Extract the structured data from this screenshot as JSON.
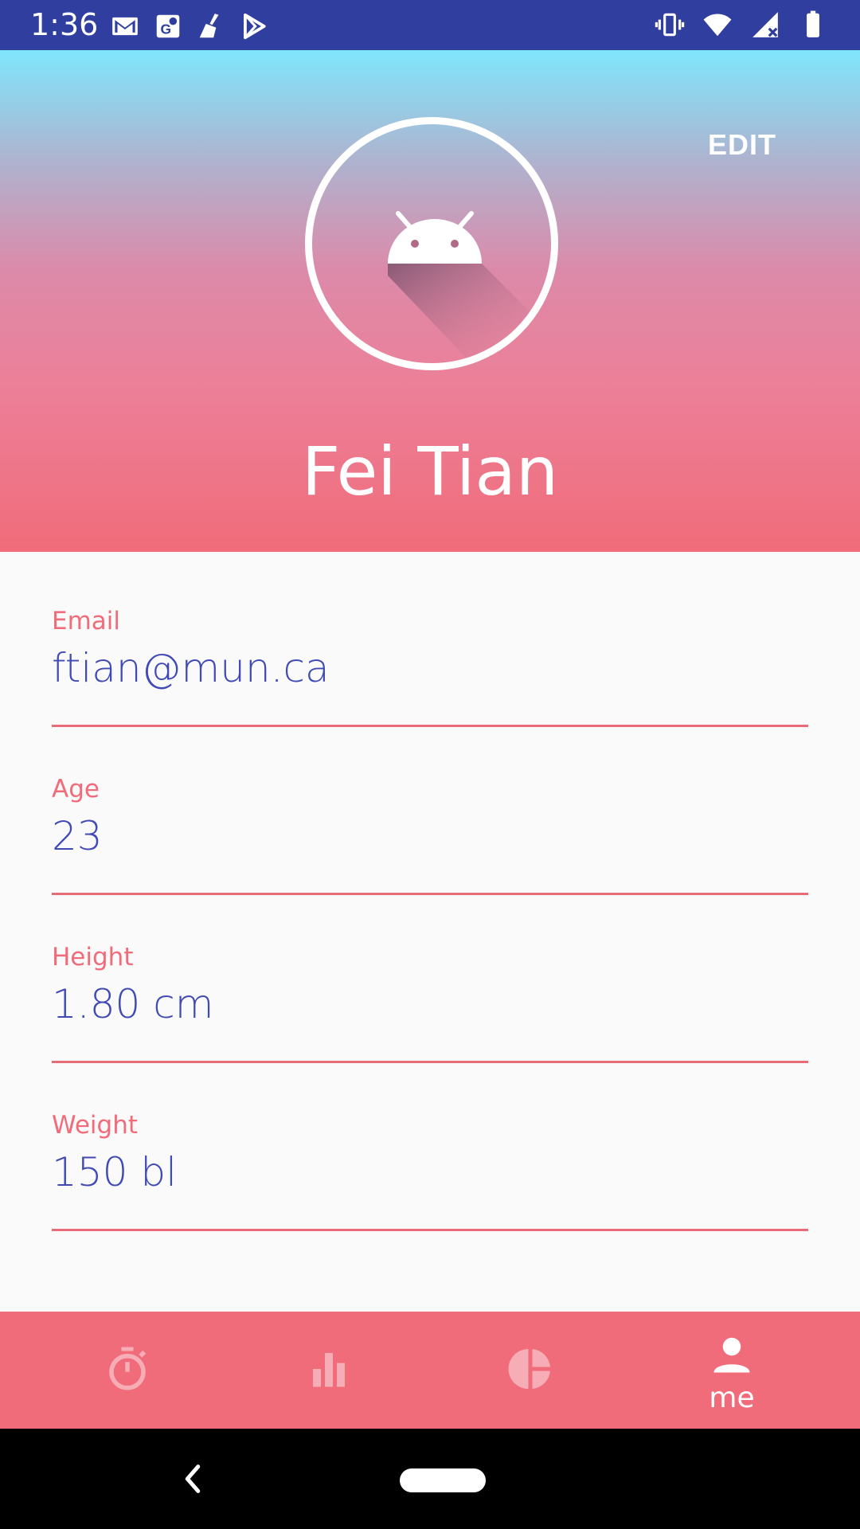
{
  "status_bar": {
    "time": "1:36",
    "left_icons": [
      "gmail-icon",
      "maps-icon",
      "broom-icon",
      "play-store-icon"
    ],
    "right_icons": [
      "vibrate-icon",
      "wifi-icon",
      "signal-icon",
      "battery-icon"
    ]
  },
  "header": {
    "edit_label": "EDIT",
    "name": "Fei Tian",
    "gradient_colors": [
      "#7fe6fc",
      "#aeb3cf",
      "#dc8aa9",
      "#ec8099",
      "#f06c7a"
    ]
  },
  "fields": [
    {
      "label": "Email",
      "value": "ftian@mun.ca"
    },
    {
      "label": "Age",
      "value": "23"
    },
    {
      "label": "Height",
      "value": "1.80 cm"
    },
    {
      "label": "Weight",
      "value": "150 bl"
    }
  ],
  "bottom_nav": {
    "items": [
      {
        "icon": "timer-icon",
        "label": ""
      },
      {
        "icon": "bar-chart-icon",
        "label": ""
      },
      {
        "icon": "pie-chart-icon",
        "label": ""
      },
      {
        "icon": "person-icon",
        "label": "me",
        "active": true
      }
    ]
  },
  "colors": {
    "accent": "#f06c7a",
    "value_text": "#3f4ab5",
    "status_bar": "#303f9f"
  }
}
